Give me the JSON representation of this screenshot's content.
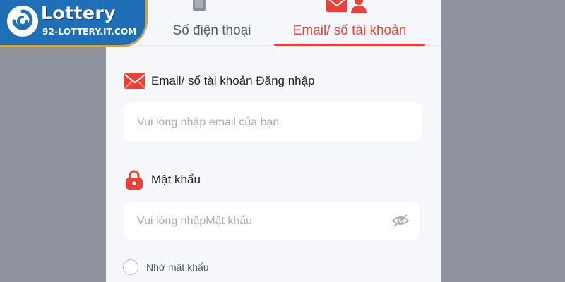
{
  "logo": {
    "title": "Lottery",
    "subtitle": "92-LOTTERY.IT.COM",
    "icon": "swirl-logo-icon",
    "color": "#1e6fb5"
  },
  "tabs": [
    {
      "label": "Số điện thoại",
      "icon": "phone-icon",
      "active": false
    },
    {
      "label": "Email/ số tài khoản",
      "icon": "email-user-icon",
      "active": true
    }
  ],
  "form": {
    "email": {
      "label": "Email/ số tài khoản Đăng nhập",
      "icon": "envelope-icon",
      "value": "",
      "placeholder": "Vui lòng nhập email của bạn"
    },
    "password": {
      "label": "Mật khẩu",
      "icon": "lock-icon",
      "value": "",
      "placeholder": "Vui lòng nhậpMật khẩu",
      "toggle_icon": "eye-off-icon"
    },
    "remember": {
      "label": "Nhớ mật khẩu",
      "checked": false
    }
  },
  "colors": {
    "accent": "#e8423b",
    "panel_bg": "#f6f7fb",
    "page_bg": "#8f939d"
  }
}
